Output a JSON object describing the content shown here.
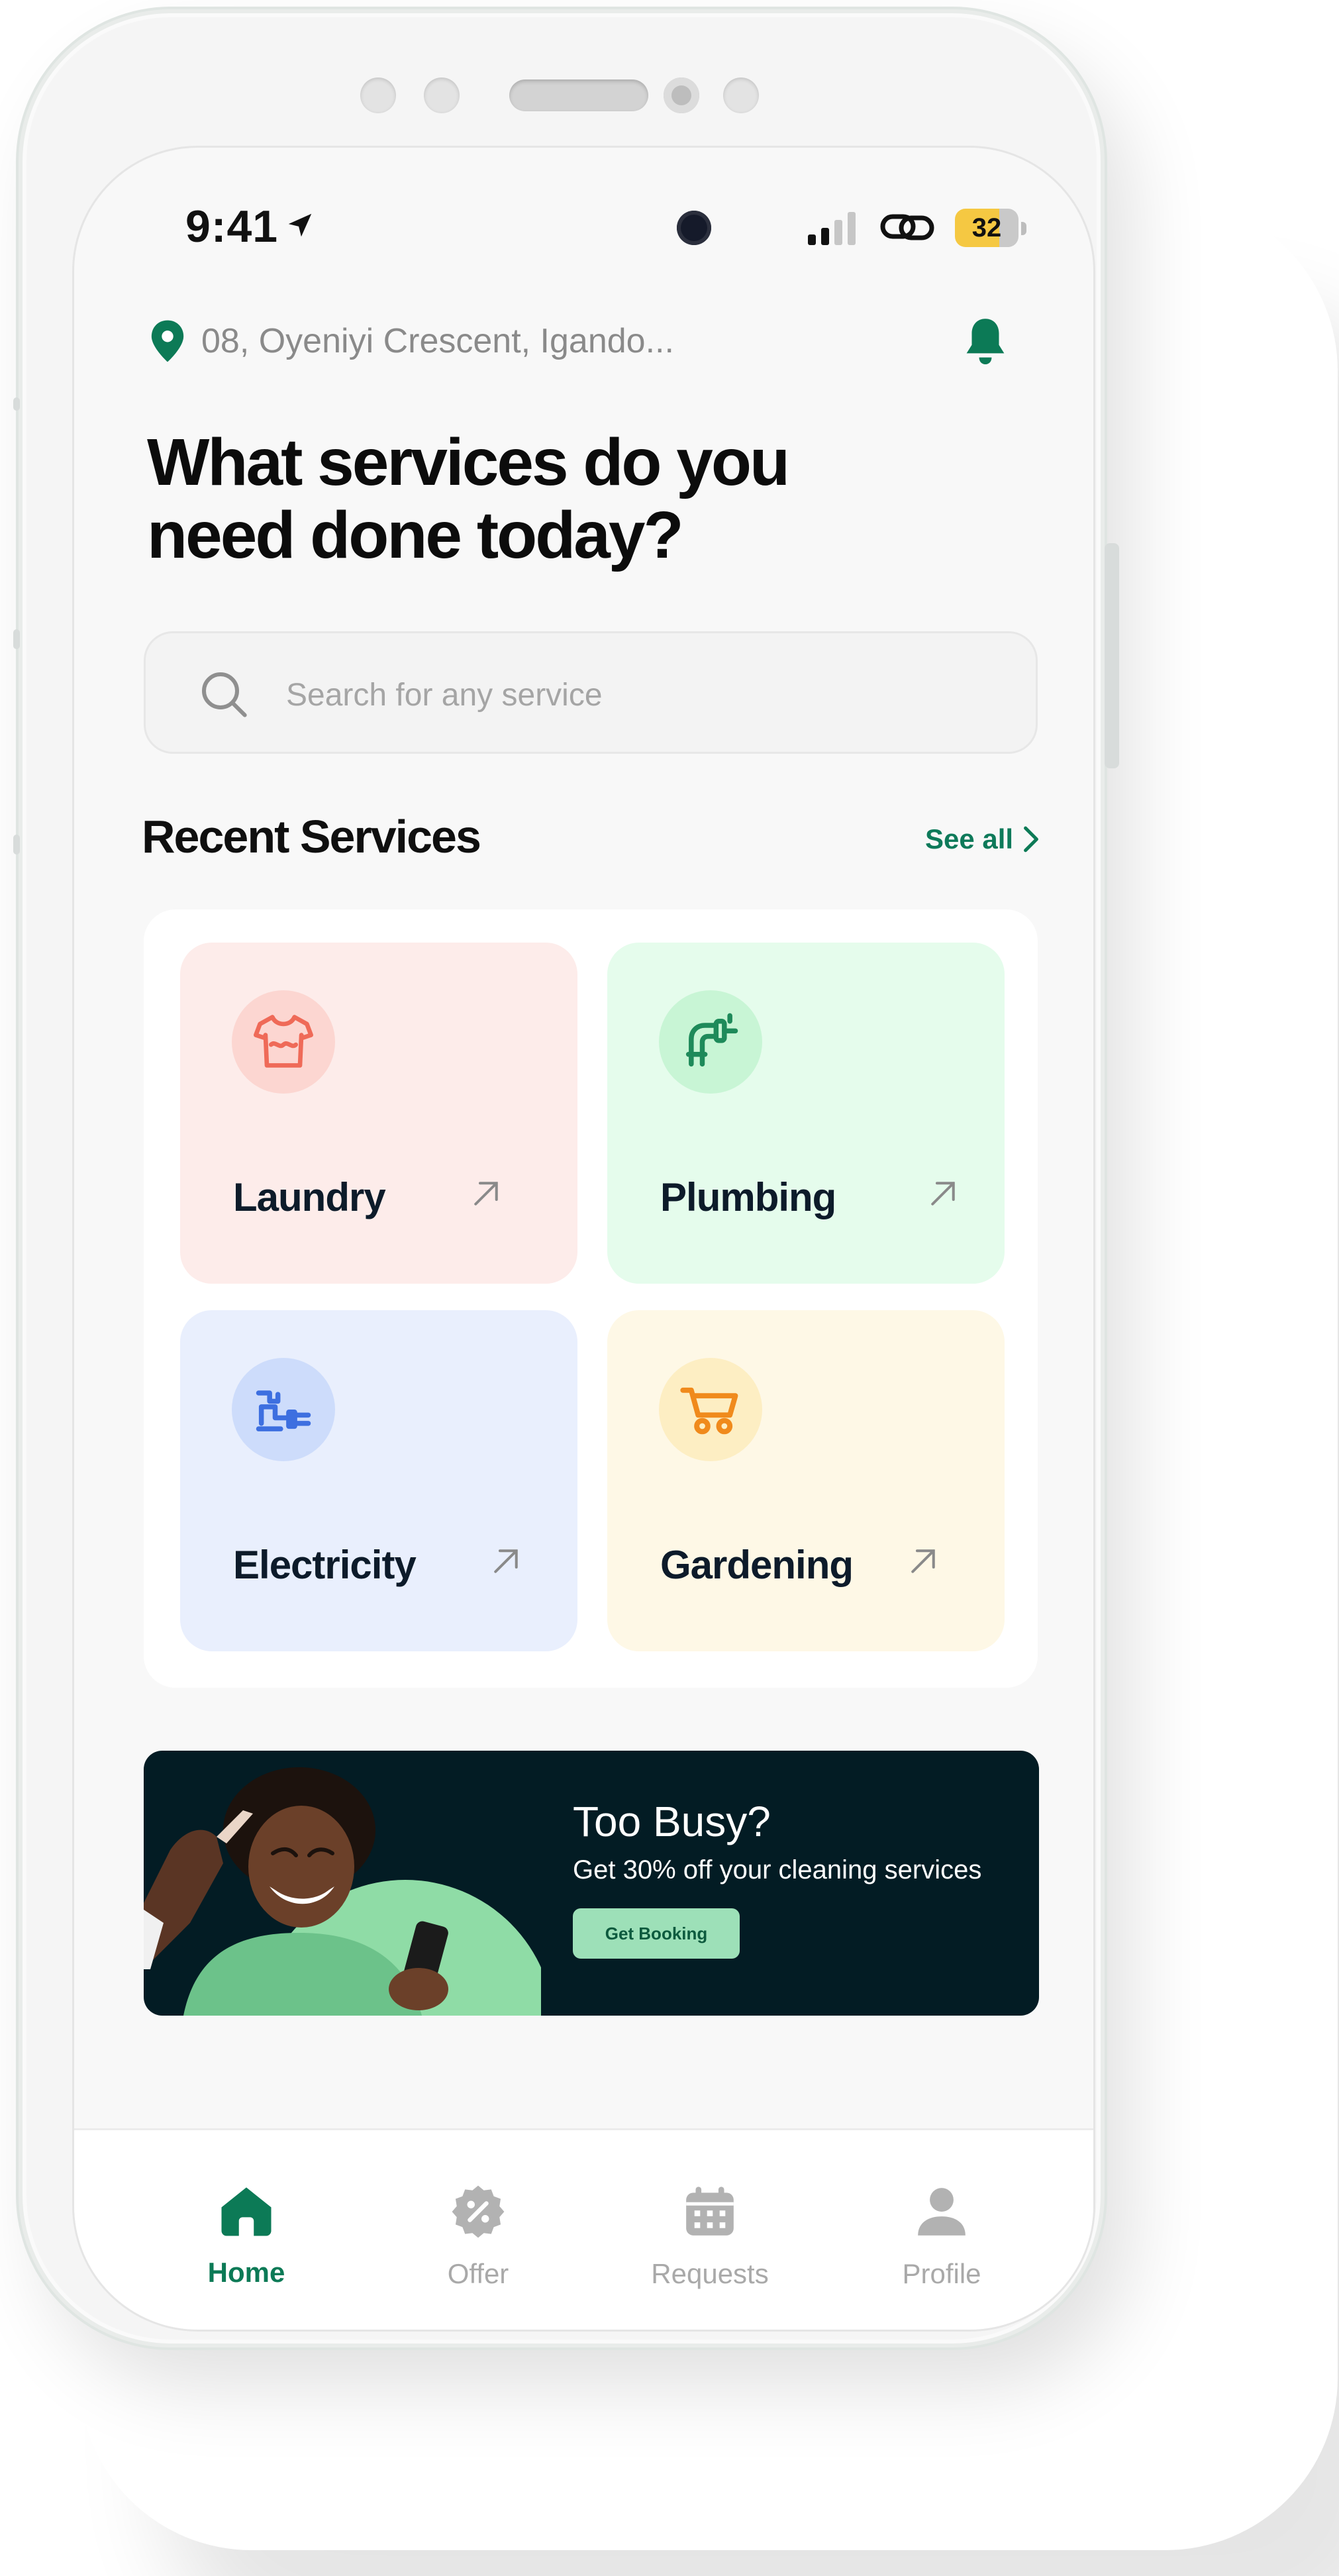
{
  "status_bar": {
    "time": "9:41",
    "battery": "32"
  },
  "header": {
    "address": "08, Oyeniyi Crescent, Igando..."
  },
  "headline": {
    "line1": "What services do you",
    "line2": "need done today?"
  },
  "search": {
    "placeholder": "Search for any service"
  },
  "recent_services": {
    "title": "Recent Services",
    "see_all": "See all",
    "items": [
      {
        "label": "Laundry",
        "icon": "tshirt-icon",
        "bg": "#fdecea",
        "icon_bg": "#fcd6d1",
        "icon_color": "#ef6a58"
      },
      {
        "label": "Plumbing",
        "icon": "faucet-icon",
        "bg": "#e5fcec",
        "icon_bg": "#c8f5d5",
        "icon_color": "#1e8a5a"
      },
      {
        "label": "Electricity",
        "icon": "plug-icon",
        "bg": "#e9effd",
        "icon_bg": "#cddcfb",
        "icon_color": "#3d6fe0"
      },
      {
        "label": "Gardening",
        "icon": "wheelbarrow-icon",
        "bg": "#fef8e6",
        "icon_bg": "#fdeec3",
        "icon_color": "#f08a1c"
      }
    ]
  },
  "promo": {
    "title": "Too Busy?",
    "subtitle": "Get 30% off your cleaning services",
    "button": "Get Booking"
  },
  "tabbar": {
    "items": [
      {
        "label": "Home",
        "icon": "home-icon",
        "active": true
      },
      {
        "label": "Offer",
        "icon": "offer-badge-icon",
        "active": false
      },
      {
        "label": "Requests",
        "icon": "calendar-icon",
        "active": false
      },
      {
        "label": "Profile",
        "icon": "person-icon",
        "active": false
      }
    ]
  },
  "colors": {
    "accent": "#0c7a56",
    "promo_bg": "#031c24",
    "promo_button": "#9de0b8"
  }
}
